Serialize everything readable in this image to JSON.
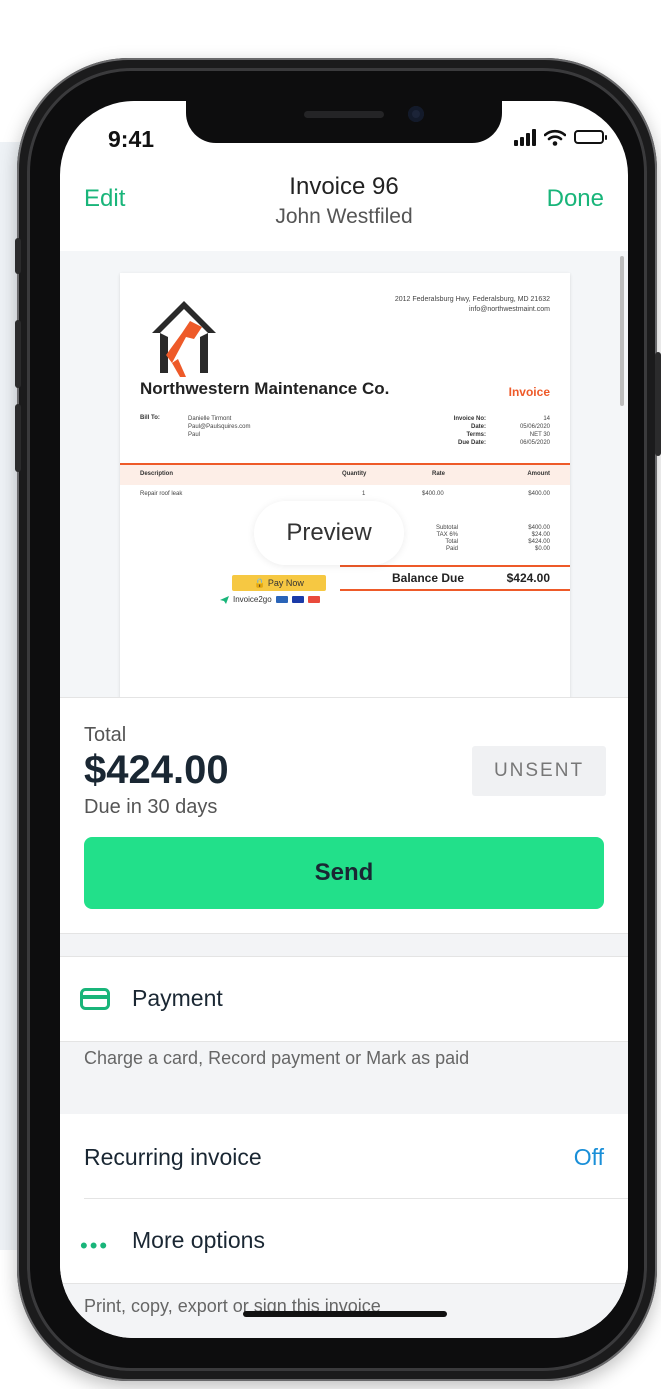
{
  "status_bar": {
    "time": "9:41"
  },
  "nav": {
    "edit_label": "Edit",
    "done_label": "Done",
    "title": "Invoice 96",
    "subtitle": "John Westfiled"
  },
  "document": {
    "address_line1": "2012 Federalsburg Hwy, Federalsburg, MD 21632",
    "address_line2": "info@northwestmaint.com",
    "company": "Northwestern Maintenance Co.",
    "doc_type": "Invoice",
    "bill_to_label": "Bill To:",
    "bill_to_name": "Danielle Tirmont",
    "bill_to_email": "Paul@Paulsquires.com",
    "bill_to_extra": "Paul",
    "meta_labels": [
      "Invoice No:",
      "Date:",
      "Terms:",
      "Due Date:"
    ],
    "meta_values": [
      "14",
      "05/06/2020",
      "NET 30",
      "06/05/2020"
    ],
    "columns": [
      "Description",
      "Quantity",
      "Rate",
      "Amount"
    ],
    "rows": [
      {
        "description": "Repair roof leak",
        "quantity": "1",
        "rate": "$400.00",
        "amount": "$400.00"
      }
    ],
    "totals_labels": [
      "Subtotal",
      "TAX 6%",
      "Total",
      "Paid"
    ],
    "totals_values": [
      "$400.00",
      "$24.00",
      "$424.00",
      "$0.00"
    ],
    "balance_label": "Balance Due",
    "balance_value": "$424.00",
    "pay_now_label": "🔒 Pay Now",
    "brand_label": "Invoice2go"
  },
  "preview": {
    "label": "Preview"
  },
  "summary": {
    "total_label": "Total",
    "total_amount": "$424.00",
    "due_text": "Due in 30 days",
    "status_badge": "UNSENT",
    "send_label": "Send"
  },
  "payment": {
    "label": "Payment",
    "hint": "Charge a card, Record payment or Mark as paid"
  },
  "recurring": {
    "label": "Recurring invoice",
    "value": "Off"
  },
  "more_options": {
    "label": "More options",
    "hint": "Print, copy, export or sign this invoice"
  },
  "colors": {
    "accent_green": "#19b57a",
    "send_button": "#22e08a",
    "invoice_orange": "#ee5a29",
    "link_blue": "#1a8fd8"
  }
}
